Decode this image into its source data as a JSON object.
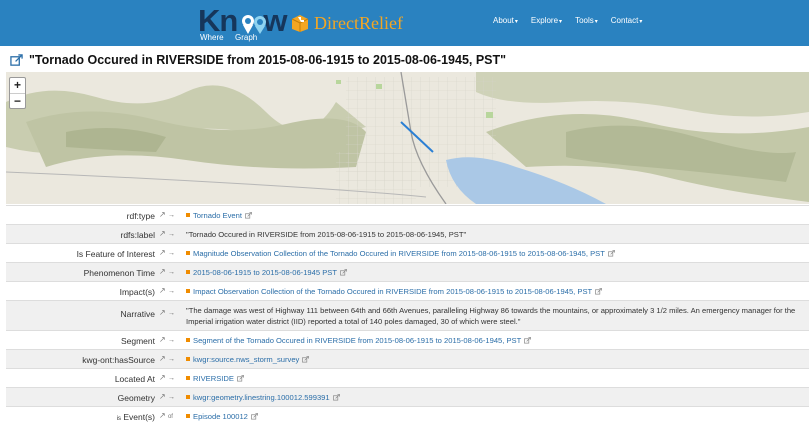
{
  "navbar": {
    "logo_main": "Kn",
    "logo_main_tail": "w",
    "logo_sub_where": "Where",
    "logo_sub_graph": "Graph",
    "brand_partner": "DirectRelief",
    "menu": [
      {
        "label": "About"
      },
      {
        "label": "Explore"
      },
      {
        "label": "Tools"
      },
      {
        "label": "Contact"
      }
    ],
    "color": "#2a82c0"
  },
  "page": {
    "title": "\"Tornado Occured in RIVERSIDE from 2015-08-06-1915 to 2015-08-06-1945, PST\""
  },
  "map": {
    "zoom_in": "+",
    "zoom_out": "−"
  },
  "properties": [
    {
      "key": "rdf:type",
      "value": "Tornado Event",
      "is_link": true
    },
    {
      "key": "rdfs:label",
      "value": "\"Tornado Occured in RIVERSIDE from 2015-08-06-1915 to 2015-08-06-1945, PST\"",
      "is_link": false
    },
    {
      "key": "Is Feature of Interest",
      "value": "Magnitude Observation Collection of the Tornado Occured in RIVERSIDE from 2015-08-06-1915 to 2015-08-06-1945, PST",
      "is_link": true
    },
    {
      "key": "Phenomenon Time",
      "value": "2015-08-06-1915 to 2015-08-06-1945 PST",
      "is_link": true
    },
    {
      "key": "Impact(s)",
      "value": "Impact Observation Collection of the Tornado Occured in RIVERSIDE from 2015-08-06-1915 to 2015-08-06-1945, PST",
      "is_link": true
    },
    {
      "key": "Narrative",
      "value": "\"The damage was west of Highway 111 between 64th and 66th Avenues, paralleling Highway 86 towards the mountains, or approximately 3 1/2 miles. An emergency manager for the Imperial irrigation water district (IID) reported a total of 140 poles damaged, 30 of which were steel.\"",
      "is_link": false
    },
    {
      "key": "Segment",
      "value": "Segment of the Tornado Occured in RIVERSIDE from 2015-08-06-1915 to 2015-08-06-1945, PST",
      "is_link": true
    },
    {
      "key": "kwg-ont:hasSource",
      "value": "kwgr:source.nws_storm_survey",
      "is_link": true
    },
    {
      "key": "Located At",
      "value": "RIVERSIDE",
      "is_link": true
    },
    {
      "key": "Geometry",
      "value": "kwgr:geometry.linestring.100012.599391",
      "is_link": true
    },
    {
      "key_prefix": "is",
      "key": "Event(s)",
      "inverse_label": "of",
      "value": "Episode 100012",
      "is_link": true
    }
  ],
  "colors": {
    "link": "#2b6ea8",
    "bullet": "#f08c00",
    "tornado_path": "#2a7fd4"
  }
}
